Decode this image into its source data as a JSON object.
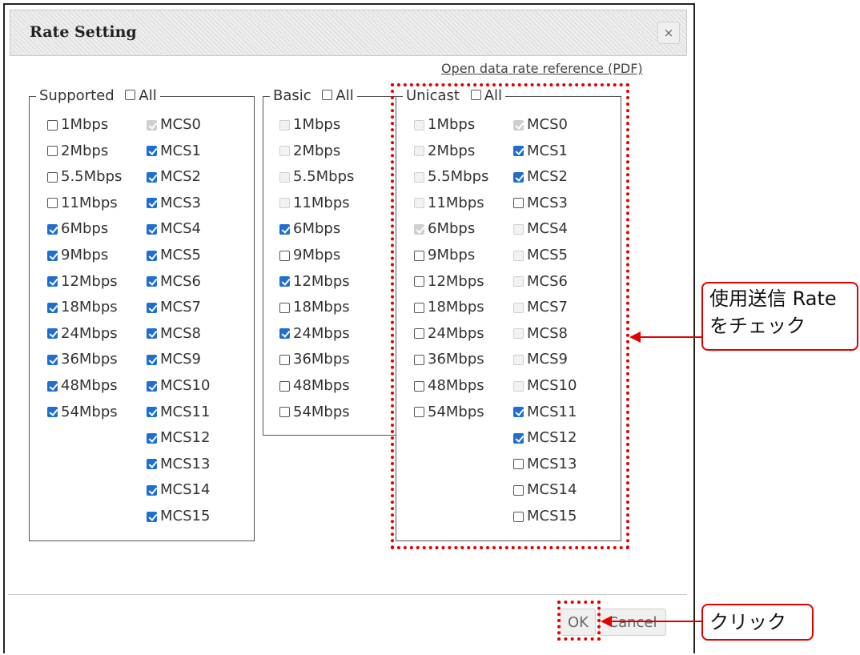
{
  "dialog": {
    "title": "Rate Setting",
    "close_glyph": "×",
    "reference_link": "Open data rate reference (PDF)"
  },
  "supported": {
    "legend": "Supported",
    "all_label": "All",
    "all_checked": false,
    "col1": [
      {
        "label": "1Mbps",
        "checked": false,
        "disabled": false
      },
      {
        "label": "2Mbps",
        "checked": false,
        "disabled": false
      },
      {
        "label": "5.5Mbps",
        "checked": false,
        "disabled": false
      },
      {
        "label": "11Mbps",
        "checked": false,
        "disabled": false
      },
      {
        "label": "6Mbps",
        "checked": true,
        "disabled": false
      },
      {
        "label": "9Mbps",
        "checked": true,
        "disabled": false
      },
      {
        "label": "12Mbps",
        "checked": true,
        "disabled": false
      },
      {
        "label": "18Mbps",
        "checked": true,
        "disabled": false
      },
      {
        "label": "24Mbps",
        "checked": true,
        "disabled": false
      },
      {
        "label": "36Mbps",
        "checked": true,
        "disabled": false
      },
      {
        "label": "48Mbps",
        "checked": true,
        "disabled": false
      },
      {
        "label": "54Mbps",
        "checked": true,
        "disabled": false
      }
    ],
    "col2": [
      {
        "label": "MCS0",
        "checked": true,
        "disabled": true
      },
      {
        "label": "MCS1",
        "checked": true,
        "disabled": false
      },
      {
        "label": "MCS2",
        "checked": true,
        "disabled": false
      },
      {
        "label": "MCS3",
        "checked": true,
        "disabled": false
      },
      {
        "label": "MCS4",
        "checked": true,
        "disabled": false
      },
      {
        "label": "MCS5",
        "checked": true,
        "disabled": false
      },
      {
        "label": "MCS6",
        "checked": true,
        "disabled": false
      },
      {
        "label": "MCS7",
        "checked": true,
        "disabled": false
      },
      {
        "label": "MCS8",
        "checked": true,
        "disabled": false
      },
      {
        "label": "MCS9",
        "checked": true,
        "disabled": false
      },
      {
        "label": "MCS10",
        "checked": true,
        "disabled": false
      },
      {
        "label": "MCS11",
        "checked": true,
        "disabled": false
      },
      {
        "label": "MCS12",
        "checked": true,
        "disabled": false
      },
      {
        "label": "MCS13",
        "checked": true,
        "disabled": false
      },
      {
        "label": "MCS14",
        "checked": true,
        "disabled": false
      },
      {
        "label": "MCS15",
        "checked": true,
        "disabled": false
      }
    ]
  },
  "basic": {
    "legend": "Basic",
    "all_label": "All",
    "all_checked": false,
    "col1": [
      {
        "label": "1Mbps",
        "checked": false,
        "disabled": true
      },
      {
        "label": "2Mbps",
        "checked": false,
        "disabled": true
      },
      {
        "label": "5.5Mbps",
        "checked": false,
        "disabled": true
      },
      {
        "label": "11Mbps",
        "checked": false,
        "disabled": true
      },
      {
        "label": "6Mbps",
        "checked": true,
        "disabled": false
      },
      {
        "label": "9Mbps",
        "checked": false,
        "disabled": false
      },
      {
        "label": "12Mbps",
        "checked": true,
        "disabled": false
      },
      {
        "label": "18Mbps",
        "checked": false,
        "disabled": false
      },
      {
        "label": "24Mbps",
        "checked": true,
        "disabled": false
      },
      {
        "label": "36Mbps",
        "checked": false,
        "disabled": false
      },
      {
        "label": "48Mbps",
        "checked": false,
        "disabled": false
      },
      {
        "label": "54Mbps",
        "checked": false,
        "disabled": false
      }
    ]
  },
  "unicast": {
    "legend": "Unicast",
    "all_label": "All",
    "all_checked": false,
    "col1": [
      {
        "label": "1Mbps",
        "checked": false,
        "disabled": true
      },
      {
        "label": "2Mbps",
        "checked": false,
        "disabled": true
      },
      {
        "label": "5.5Mbps",
        "checked": false,
        "disabled": true
      },
      {
        "label": "11Mbps",
        "checked": false,
        "disabled": true
      },
      {
        "label": "6Mbps",
        "checked": true,
        "disabled": true
      },
      {
        "label": "9Mbps",
        "checked": false,
        "disabled": false
      },
      {
        "label": "12Mbps",
        "checked": false,
        "disabled": false
      },
      {
        "label": "18Mbps",
        "checked": false,
        "disabled": false
      },
      {
        "label": "24Mbps",
        "checked": false,
        "disabled": false
      },
      {
        "label": "36Mbps",
        "checked": false,
        "disabled": false
      },
      {
        "label": "48Mbps",
        "checked": false,
        "disabled": false
      },
      {
        "label": "54Mbps",
        "checked": false,
        "disabled": false
      }
    ],
    "col2": [
      {
        "label": "MCS0",
        "checked": true,
        "disabled": true
      },
      {
        "label": "MCS1",
        "checked": true,
        "disabled": false
      },
      {
        "label": "MCS2",
        "checked": true,
        "disabled": false
      },
      {
        "label": "MCS3",
        "checked": false,
        "disabled": false
      },
      {
        "label": "MCS4",
        "checked": false,
        "disabled": true
      },
      {
        "label": "MCS5",
        "checked": false,
        "disabled": true
      },
      {
        "label": "MCS6",
        "checked": false,
        "disabled": true
      },
      {
        "label": "MCS7",
        "checked": false,
        "disabled": true
      },
      {
        "label": "MCS8",
        "checked": false,
        "disabled": true
      },
      {
        "label": "MCS9",
        "checked": false,
        "disabled": true
      },
      {
        "label": "MCS10",
        "checked": false,
        "disabled": true
      },
      {
        "label": "MCS11",
        "checked": true,
        "disabled": false
      },
      {
        "label": "MCS12",
        "checked": true,
        "disabled": false
      },
      {
        "label": "MCS13",
        "checked": false,
        "disabled": false
      },
      {
        "label": "MCS14",
        "checked": false,
        "disabled": false
      },
      {
        "label": "MCS15",
        "checked": false,
        "disabled": false
      }
    ]
  },
  "buttons": {
    "ok": "OK",
    "cancel": "Cancel"
  },
  "annotations": {
    "rate_note_line1": "使用送信 Rate",
    "rate_note_line2": "をチェック",
    "click_note": "クリック",
    "highlight_color": "#e00000"
  }
}
